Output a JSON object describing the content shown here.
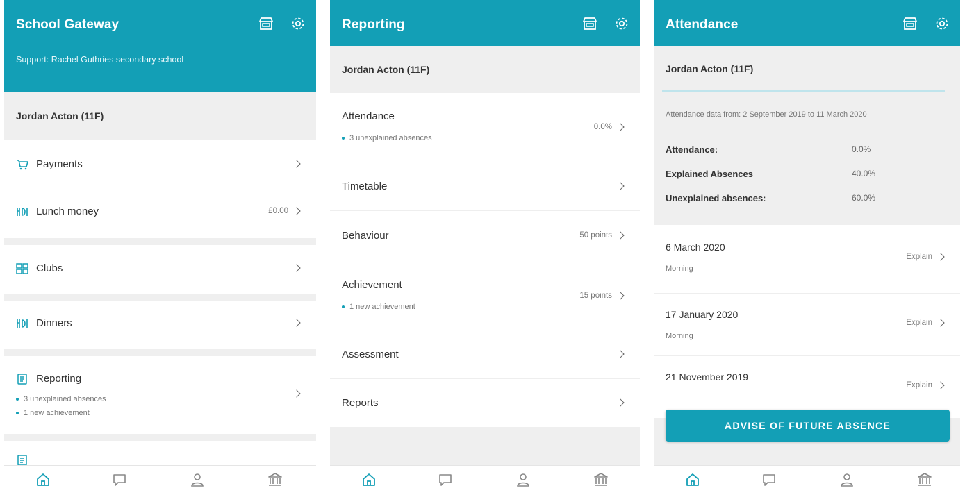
{
  "colors": {
    "brand": "#139fb6",
    "background": "#efefef"
  },
  "screen1": {
    "title": "School Gateway",
    "support": "Support: Rachel Guthries secondary school",
    "student": "Jordan Acton (11F)",
    "payments": "Payments",
    "lunch": "Lunch money",
    "lunch_value": "£0.00",
    "clubs": "Clubs",
    "dinners": "Dinners",
    "reporting": "Reporting",
    "reporting_b1": "3 unexplained absences",
    "reporting_b2": "1 new achievement"
  },
  "screen2": {
    "title": "Reporting",
    "student": "Jordan Acton (11F)",
    "attendance": "Attendance",
    "attendance_value": "0.0%",
    "attendance_b1": "3 unexplained absences",
    "timetable": "Timetable",
    "behaviour": "Behaviour",
    "behaviour_value": "50 points",
    "achievement": "Achievement",
    "achievement_value": "15 points",
    "achievement_b1": "1 new achievement",
    "assessment": "Assessment",
    "reports": "Reports"
  },
  "screen3": {
    "title": "Attendance",
    "student": "Jordan Acton (11F)",
    "range": "Attendance data from: 2 September 2019 to 11 March 2020",
    "attendance_label": "Attendance:",
    "attendance_value": "0.0%",
    "explained_label": "Explained Absences",
    "explained_value": "40.0%",
    "unexplained_label": "Unexplained absences:",
    "unexplained_value": "60.0%",
    "absences": [
      {
        "date": "6 March 2020",
        "session": "Morning",
        "action": "Explain"
      },
      {
        "date": "17 January 2020",
        "session": "Morning",
        "action": "Explain"
      },
      {
        "date": "21 November 2019",
        "session": "",
        "action": "Explain"
      }
    ],
    "advise": "ADVISE OF FUTURE ABSENCE"
  },
  "icons": [
    "shop-icon",
    "gear-icon",
    "cart-icon",
    "cutlery-icon",
    "clubs-icon",
    "report-icon",
    "home-icon",
    "chat-icon",
    "person-icon",
    "school-icon",
    "chevron-right-icon"
  ]
}
